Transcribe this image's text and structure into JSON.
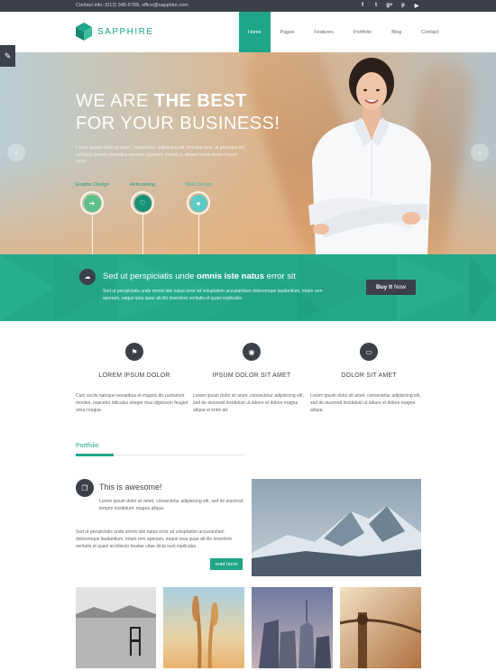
{
  "topbar": {
    "contact": "Contact info: (012) 345-6789, office@sapphire.com",
    "social": [
      {
        "icon": "facebook-icon",
        "glyph": "f"
      },
      {
        "icon": "twitter-icon",
        "glyph": "t"
      },
      {
        "icon": "google-plus-icon",
        "glyph": "g+"
      },
      {
        "icon": "pinterest-icon",
        "glyph": "p"
      },
      {
        "icon": "youtube-icon",
        "glyph": "▶"
      }
    ]
  },
  "header": {
    "brand": "SAPPHIRE",
    "nav": [
      "Home",
      "Pages",
      "Features",
      "Portfolio",
      "Blog",
      "Contact"
    ]
  },
  "hero": {
    "line1_a": "WE ARE ",
    "line1_b": "THE BEST",
    "line2": "FOR YOUR BUSINESS!",
    "lead": "Lorem ipsum dolor sit amet, consectetur adipiscing elit pharetra uma, at pharetra orci vehicula laoreet phasellus suscipit vulputate mauris a, aliquet lorem lorem mauris lacus.",
    "skills": [
      "Graphic Design",
      "Airbrushing",
      "Web Design"
    ]
  },
  "promo": {
    "head_a": "Sed ut perspiciatis unde ",
    "head_b": "omnis iste natus",
    "head_c": " error sit",
    "body": "Sed ut perspiciatis unde omnis iste natus error sit voluptatem accusantium doloremque laudantium, totam rem aperiam, eaque ipsa quae ab illo inventore veritatis et quasi explicabo.",
    "button_b": "Buy It",
    "button_rest": "Now"
  },
  "features": [
    {
      "icon": "flag-icon",
      "title": "LOREM IPSUM DOLOR",
      "text": "Cum sociis natoque penatibus et magnis dis parturient montes, nascetur ridiculus integer mus dignissim feugiat urna congue."
    },
    {
      "icon": "lightbulb-icon",
      "title": "IPSUM DOLOR SIT AMET",
      "text": "Lorem ipsum dolor sit amet, consectetur adipisicing elit, sed do eiusmod incididunt ut labore et dolore magna aliqua ut enim ad."
    },
    {
      "icon": "folder-icon",
      "title": "DOLOR SIT AMET",
      "text": "Lorem ipsum dolor sit amet, consectetur adipisicing elit, sed do eiusmod incididunt ut labore et dolore magna aliqua."
    }
  ],
  "portfolio": {
    "heading": "Portfolio",
    "title": "This is awesome!",
    "sub": "Lorem ipsum dolor sit amet, consectetur adipisicing elit, sed do eiusmod tempor incididunt. magna aliqua.",
    "body": "Sed ut perspiciatis unde omnis iste natus error sit voluptatem accusantium doloremque laudantium, totam rem aperiam, eaque ipsa quae ab illo inventore veritatis et quasi architecto beatae vitae dicta sunt explicabo.",
    "read_more": "read more"
  },
  "colors": {
    "accent": "#1fa588",
    "dark": "#3b4049"
  }
}
